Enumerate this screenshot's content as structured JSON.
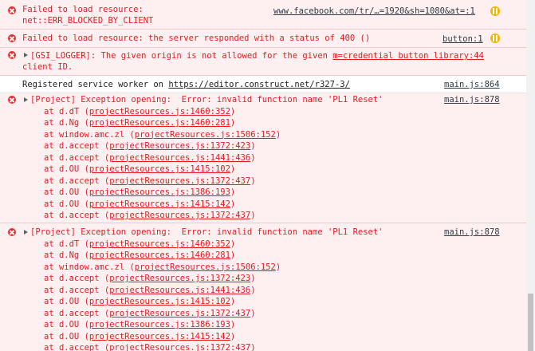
{
  "messages": [
    {
      "type": "error",
      "lines": [
        "Failed to load resource:",
        "net::ERR_BLOCKED_BY_CLIENT"
      ],
      "source": "www.facebook.com/tr/…=1920&sh=1080&at=:1"
    },
    {
      "type": "error",
      "lines": [
        "Failed to load resource: the server responded with a status of 400 ()"
      ],
      "source": "button:1"
    },
    {
      "type": "error",
      "prefix": "[GSI_LOGGER]: The given origin is not allowed for the given ",
      "source": "m=credential button library:44",
      "line2": "client ID."
    },
    {
      "type": "log",
      "text": "Registered service worker on ",
      "url": "https://editor.construct.net/r327-3/",
      "source": "main.js:864"
    },
    {
      "type": "error",
      "summary": "[Project] Exception opening:  Error: invalid function name 'PL1 Reset'",
      "source": "main.js:878",
      "stack": [
        {
          "fn": "at d.dT (",
          "loc": "projectResources.js:1460:352"
        },
        {
          "fn": "at d.Ng (",
          "loc": "projectResources.js:1460:281"
        },
        {
          "fn": "at window.amc.zl (",
          "loc": "projectResources.js:1506:152"
        },
        {
          "fn": "at d.accept (",
          "loc": "projectResources.js:1372:423"
        },
        {
          "fn": "at d.accept (",
          "loc": "projectResources.js:1441:436"
        },
        {
          "fn": "at d.OU (",
          "loc": "projectResources.js:1415:102"
        },
        {
          "fn": "at d.accept (",
          "loc": "projectResources.js:1372:437"
        },
        {
          "fn": "at d.OU (",
          "loc": "projectResources.js:1386:193"
        },
        {
          "fn": "at d.OU (",
          "loc": "projectResources.js:1415:142"
        },
        {
          "fn": "at d.accept (",
          "loc": "projectResources.js:1372:437"
        }
      ]
    },
    {
      "type": "error",
      "summary": "[Project] Exception opening:  Error: invalid function name 'PL1 Reset'",
      "source": "main.js:878",
      "stack": [
        {
          "fn": "at d.dT (",
          "loc": "projectResources.js:1460:352"
        },
        {
          "fn": "at d.Ng (",
          "loc": "projectResources.js:1460:281"
        },
        {
          "fn": "at window.amc.zl (",
          "loc": "projectResources.js:1506:152"
        },
        {
          "fn": "at d.accept (",
          "loc": "projectResources.js:1372:423"
        },
        {
          "fn": "at d.accept (",
          "loc": "projectResources.js:1441:436"
        },
        {
          "fn": "at d.OU (",
          "loc": "projectResources.js:1415:102"
        },
        {
          "fn": "at d.accept (",
          "loc": "projectResources.js:1372:437"
        },
        {
          "fn": "at d.OU (",
          "loc": "projectResources.js:1386:193"
        },
        {
          "fn": "at d.OU (",
          "loc": "projectResources.js:1415:142"
        },
        {
          "fn": "at d.accept (",
          "loc": "projectResources.js:1372:437"
        }
      ]
    }
  ],
  "icons": {
    "error": "error-circle-icon",
    "network": "network-request-icon",
    "expand": "expand-triangle-icon"
  },
  "colors": {
    "error_text": "#e31b23",
    "error_bg": "#fef0f0",
    "error_icon": "#e3302f",
    "network_icon": "#f4b400"
  }
}
